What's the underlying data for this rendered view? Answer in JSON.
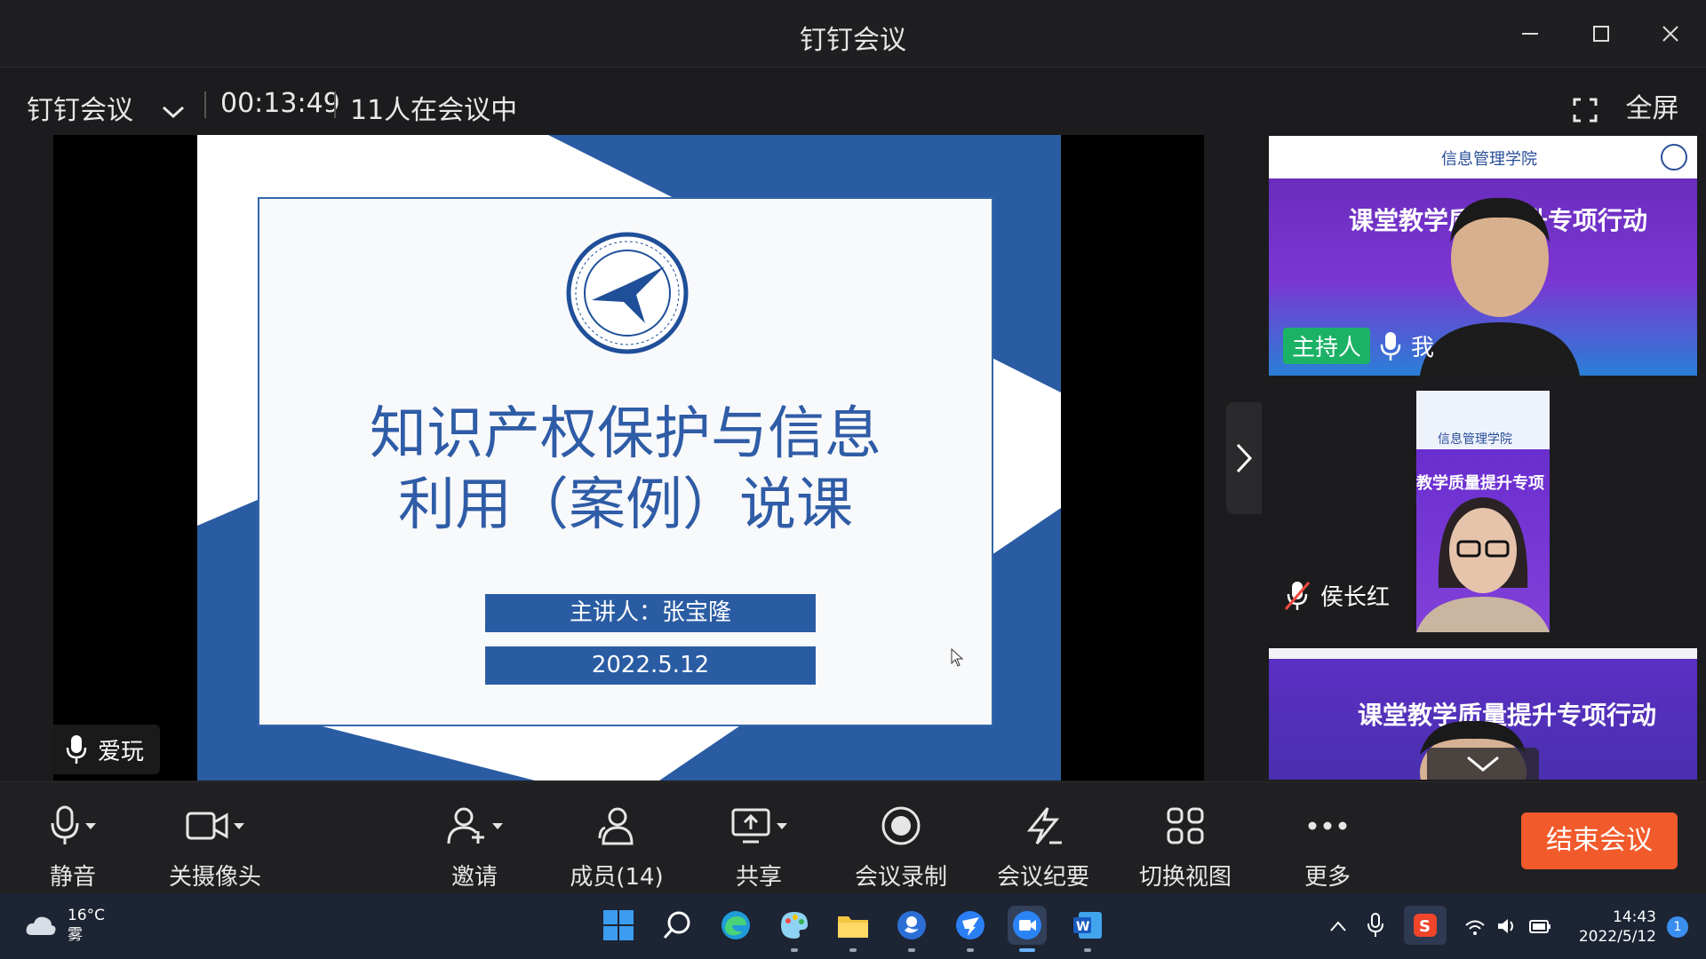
{
  "window": {
    "title": "钉钉会议"
  },
  "infobar": {
    "meeting_menu": "钉钉会议",
    "elapsed": "00:13:49",
    "participants_text": "11人在会议中",
    "fullscreen": "全屏"
  },
  "slide": {
    "title_line1": "知识产权保护与信息",
    "title_line2": "利用（案例）说课",
    "presenter": "主讲人：张宝隆",
    "date": "2022.5.12"
  },
  "stage": {
    "speaker_name": "爱玩"
  },
  "tiles": [
    {
      "badge": "主持人",
      "name": "我",
      "banner": "课堂教学质量提升专项行动",
      "header": "信息管理学院"
    },
    {
      "name": "侯长红",
      "header": "信息管理学院",
      "banner": "教学质量提升专项"
    },
    {
      "banner": "课堂教学质量提升专项行动"
    }
  ],
  "toolbar": {
    "mute": "静音",
    "camera": "关摄像头",
    "invite": "邀请",
    "members": "成员(14)",
    "share": "共享",
    "record": "会议录制",
    "minutes": "会议纪要",
    "switch_view": "切换视图",
    "more": "更多",
    "end": "结束会议"
  },
  "taskbar": {
    "temperature": "16°C",
    "weather": "雾",
    "time": "14:43",
    "date": "2022/5/12",
    "notifications": "1"
  },
  "colors": {
    "accent_end": "#f15a2b",
    "host_badge": "#1bb266",
    "slide_blue": "#2a5ca3"
  }
}
